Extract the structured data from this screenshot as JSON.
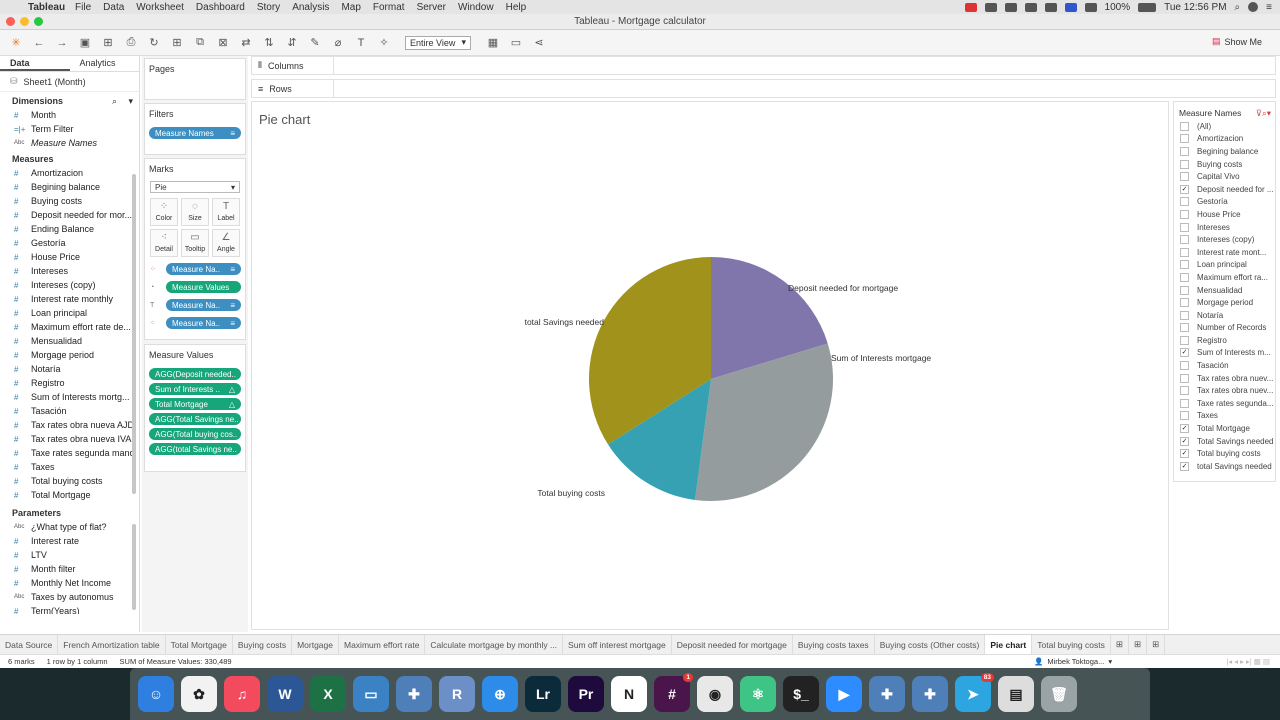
{
  "menubar": {
    "app": "Tableau",
    "items": [
      "File",
      "Data",
      "Worksheet",
      "Dashboard",
      "Story",
      "Analysis",
      "Map",
      "Format",
      "Server",
      "Window",
      "Help"
    ],
    "battery": "100%",
    "clock": "Tue 12:56 PM"
  },
  "window": {
    "title": "Tableau - Mortgage calculator"
  },
  "toolbar": {
    "fit_select": "Entire View",
    "show_me": "Show Me"
  },
  "data_pane": {
    "tabs": [
      "Data",
      "Analytics"
    ],
    "datasource": "Sheet1 (Month)",
    "dimensions_title": "Dimensions",
    "dimensions": [
      {
        "label": "Month",
        "icon": "#"
      },
      {
        "label": "Term Filter",
        "icon": "=|+"
      },
      {
        "label": "Measure Names",
        "icon": "Abc"
      }
    ],
    "measures_title": "Measures",
    "measures": [
      "Amortizacion",
      "Begining balance",
      "Buying costs",
      "Deposit needed for mor...",
      "Ending Balance",
      "Gestoría",
      "House Price",
      "Intereses",
      "Intereses (copy)",
      "Interest rate monthly",
      "Loan principal",
      "Maximum effort rate de...",
      "Mensualidad",
      "Morgage period",
      "Notaría",
      "Registro",
      "Sum of Interests mortg...",
      "Tasación",
      "Tax rates obra nueva AJD",
      "Tax rates obra nueva IVA",
      "Taxe rates segunda mano",
      "Taxes",
      "Total buying costs",
      "Total Mortgage",
      "total Savings needed"
    ],
    "parameters_title": "Parameters",
    "parameters": [
      {
        "label": "¿What type of flat?",
        "icon": "Abc"
      },
      {
        "label": "Interest rate",
        "icon": "#"
      },
      {
        "label": "LTV",
        "icon": "#"
      },
      {
        "label": "Month filter",
        "icon": "#"
      },
      {
        "label": "Monthly Net Income",
        "icon": "#"
      },
      {
        "label": "Taxes by autonomus",
        "icon": "Abc"
      },
      {
        "label": "Term(Years)",
        "icon": "#"
      }
    ]
  },
  "cards": {
    "pages": "Pages",
    "filters": "Filters",
    "filter_pill": "Measure Names",
    "marks": "Marks",
    "mark_type": "Pie",
    "mark_buttons": [
      "Color",
      "Size",
      "Label",
      "Detail",
      "Tooltip",
      "Angle"
    ],
    "mark_pills": [
      "Measure Na..",
      "Measure Values",
      "Measure Na..",
      "Measure Na.."
    ],
    "measure_values_title": "Measure Values",
    "measure_values": [
      "AGG(Deposit needed..",
      "Sum of Interests ..",
      "Total Mortgage",
      "AGG(Total Savings ne..",
      "AGG(Total buying cos..",
      "AGG(total Savings ne.."
    ]
  },
  "shelves": {
    "columns": "Columns",
    "rows": "Rows"
  },
  "view": {
    "title": "Pie chart"
  },
  "chart_data": {
    "type": "pie",
    "title": "Pie chart",
    "slices": [
      {
        "label": "Deposit needed for mortgage",
        "share": 0.203,
        "color": "#8176ab"
      },
      {
        "label": "Sum of Interests mortgage",
        "share": 0.318,
        "color": "#959c9e"
      },
      {
        "label": "Total buying costs",
        "share": 0.139,
        "color": "#35a1b3"
      },
      {
        "label": "total Savings needed",
        "share": 0.34,
        "color": "#a0921a"
      }
    ]
  },
  "legend": {
    "title": "Measure Names",
    "items": [
      {
        "label": "(All)",
        "checked": false
      },
      {
        "label": "Amortizacion",
        "checked": false
      },
      {
        "label": "Begining balance",
        "checked": false
      },
      {
        "label": "Buying costs",
        "checked": false
      },
      {
        "label": "Capital Vivo",
        "checked": false
      },
      {
        "label": "Deposit needed for ...",
        "checked": true
      },
      {
        "label": "Gestoría",
        "checked": false
      },
      {
        "label": "House Price",
        "checked": false
      },
      {
        "label": "Intereses",
        "checked": false
      },
      {
        "label": "Intereses (copy)",
        "checked": false
      },
      {
        "label": "Interest rate mont...",
        "checked": false
      },
      {
        "label": "Loan principal",
        "checked": false
      },
      {
        "label": "Maximum effort ra...",
        "checked": false
      },
      {
        "label": "Mensualidad",
        "checked": false
      },
      {
        "label": "Morgage period",
        "checked": false
      },
      {
        "label": "Notaría",
        "checked": false
      },
      {
        "label": "Number of Records",
        "checked": false
      },
      {
        "label": "Registro",
        "checked": false
      },
      {
        "label": "Sum of Interests m...",
        "checked": true
      },
      {
        "label": "Tasación",
        "checked": false
      },
      {
        "label": "Tax rates obra nuev...",
        "checked": false
      },
      {
        "label": "Tax rates obra nuev...",
        "checked": false
      },
      {
        "label": "Taxe rates segunda...",
        "checked": false
      },
      {
        "label": "Taxes",
        "checked": false
      },
      {
        "label": "Total Mortgage",
        "checked": true
      },
      {
        "label": "Total Savings needed",
        "checked": true
      },
      {
        "label": "Total buying costs",
        "checked": true
      },
      {
        "label": "total Savings needed",
        "checked": true
      }
    ]
  },
  "sheet_tabs": [
    "Data Source",
    "French Amortization table",
    "Total Mortgage",
    "Buying costs",
    "Mortgage",
    "Maximum effort rate",
    "Calculate mortgage by monthly ...",
    "Sum off interest mortgage",
    "Deposit needed for mortgage",
    "Buying costs taxes",
    "Buying costs (Other costs)",
    "Pie chart",
    "Total buying costs"
  ],
  "active_tab": "Pie chart",
  "status": {
    "marks": "6 marks",
    "rows": "1 row by 1 column",
    "sum": "SUM of Measure Values: 330,489",
    "user": "Mirbek Toktoga..."
  },
  "dock": [
    {
      "name": "finder",
      "color": "#2f7fe0",
      "glyph": "☺"
    },
    {
      "name": "photos",
      "color": "#f2f2f2",
      "glyph": "✿"
    },
    {
      "name": "music",
      "color": "#f34a5e",
      "glyph": "♫"
    },
    {
      "name": "word",
      "color": "#2b5797",
      "glyph": "W"
    },
    {
      "name": "excel",
      "color": "#1e7145",
      "glyph": "X"
    },
    {
      "name": "keynote",
      "color": "#3b82c4",
      "glyph": "▭"
    },
    {
      "name": "tableau",
      "color": "#4f7fb8",
      "glyph": "✚"
    },
    {
      "name": "r",
      "color": "#6d8fc7",
      "glyph": "R"
    },
    {
      "name": "safari",
      "color": "#2d8bea",
      "glyph": "⊕"
    },
    {
      "name": "lightroom",
      "color": "#0b2b3b",
      "glyph": "Lr"
    },
    {
      "name": "premiere",
      "color": "#1e0a3c",
      "glyph": "Pr"
    },
    {
      "name": "notion",
      "color": "#ffffff",
      "glyph": "N"
    },
    {
      "name": "slack",
      "color": "#4a154b",
      "glyph": "#",
      "badge": "1"
    },
    {
      "name": "chrome",
      "color": "#e8e8e8",
      "glyph": "◉"
    },
    {
      "name": "atom",
      "color": "#3ec485",
      "glyph": "⚛"
    },
    {
      "name": "terminal",
      "color": "#222222",
      "glyph": "$_"
    },
    {
      "name": "zoom",
      "color": "#2d8cff",
      "glyph": "▶"
    },
    {
      "name": "tableau2",
      "color": "#4f7fb8",
      "glyph": "✚"
    },
    {
      "name": "tableau3",
      "color": "#4f7fb8",
      "glyph": "✚"
    },
    {
      "name": "telegram",
      "color": "#2ca5e0",
      "glyph": "➤",
      "badge": "83"
    },
    {
      "name": "files",
      "color": "#dddddd",
      "glyph": "▤"
    },
    {
      "name": "trash",
      "color": "#9aa3a6",
      "glyph": "🗑"
    }
  ]
}
